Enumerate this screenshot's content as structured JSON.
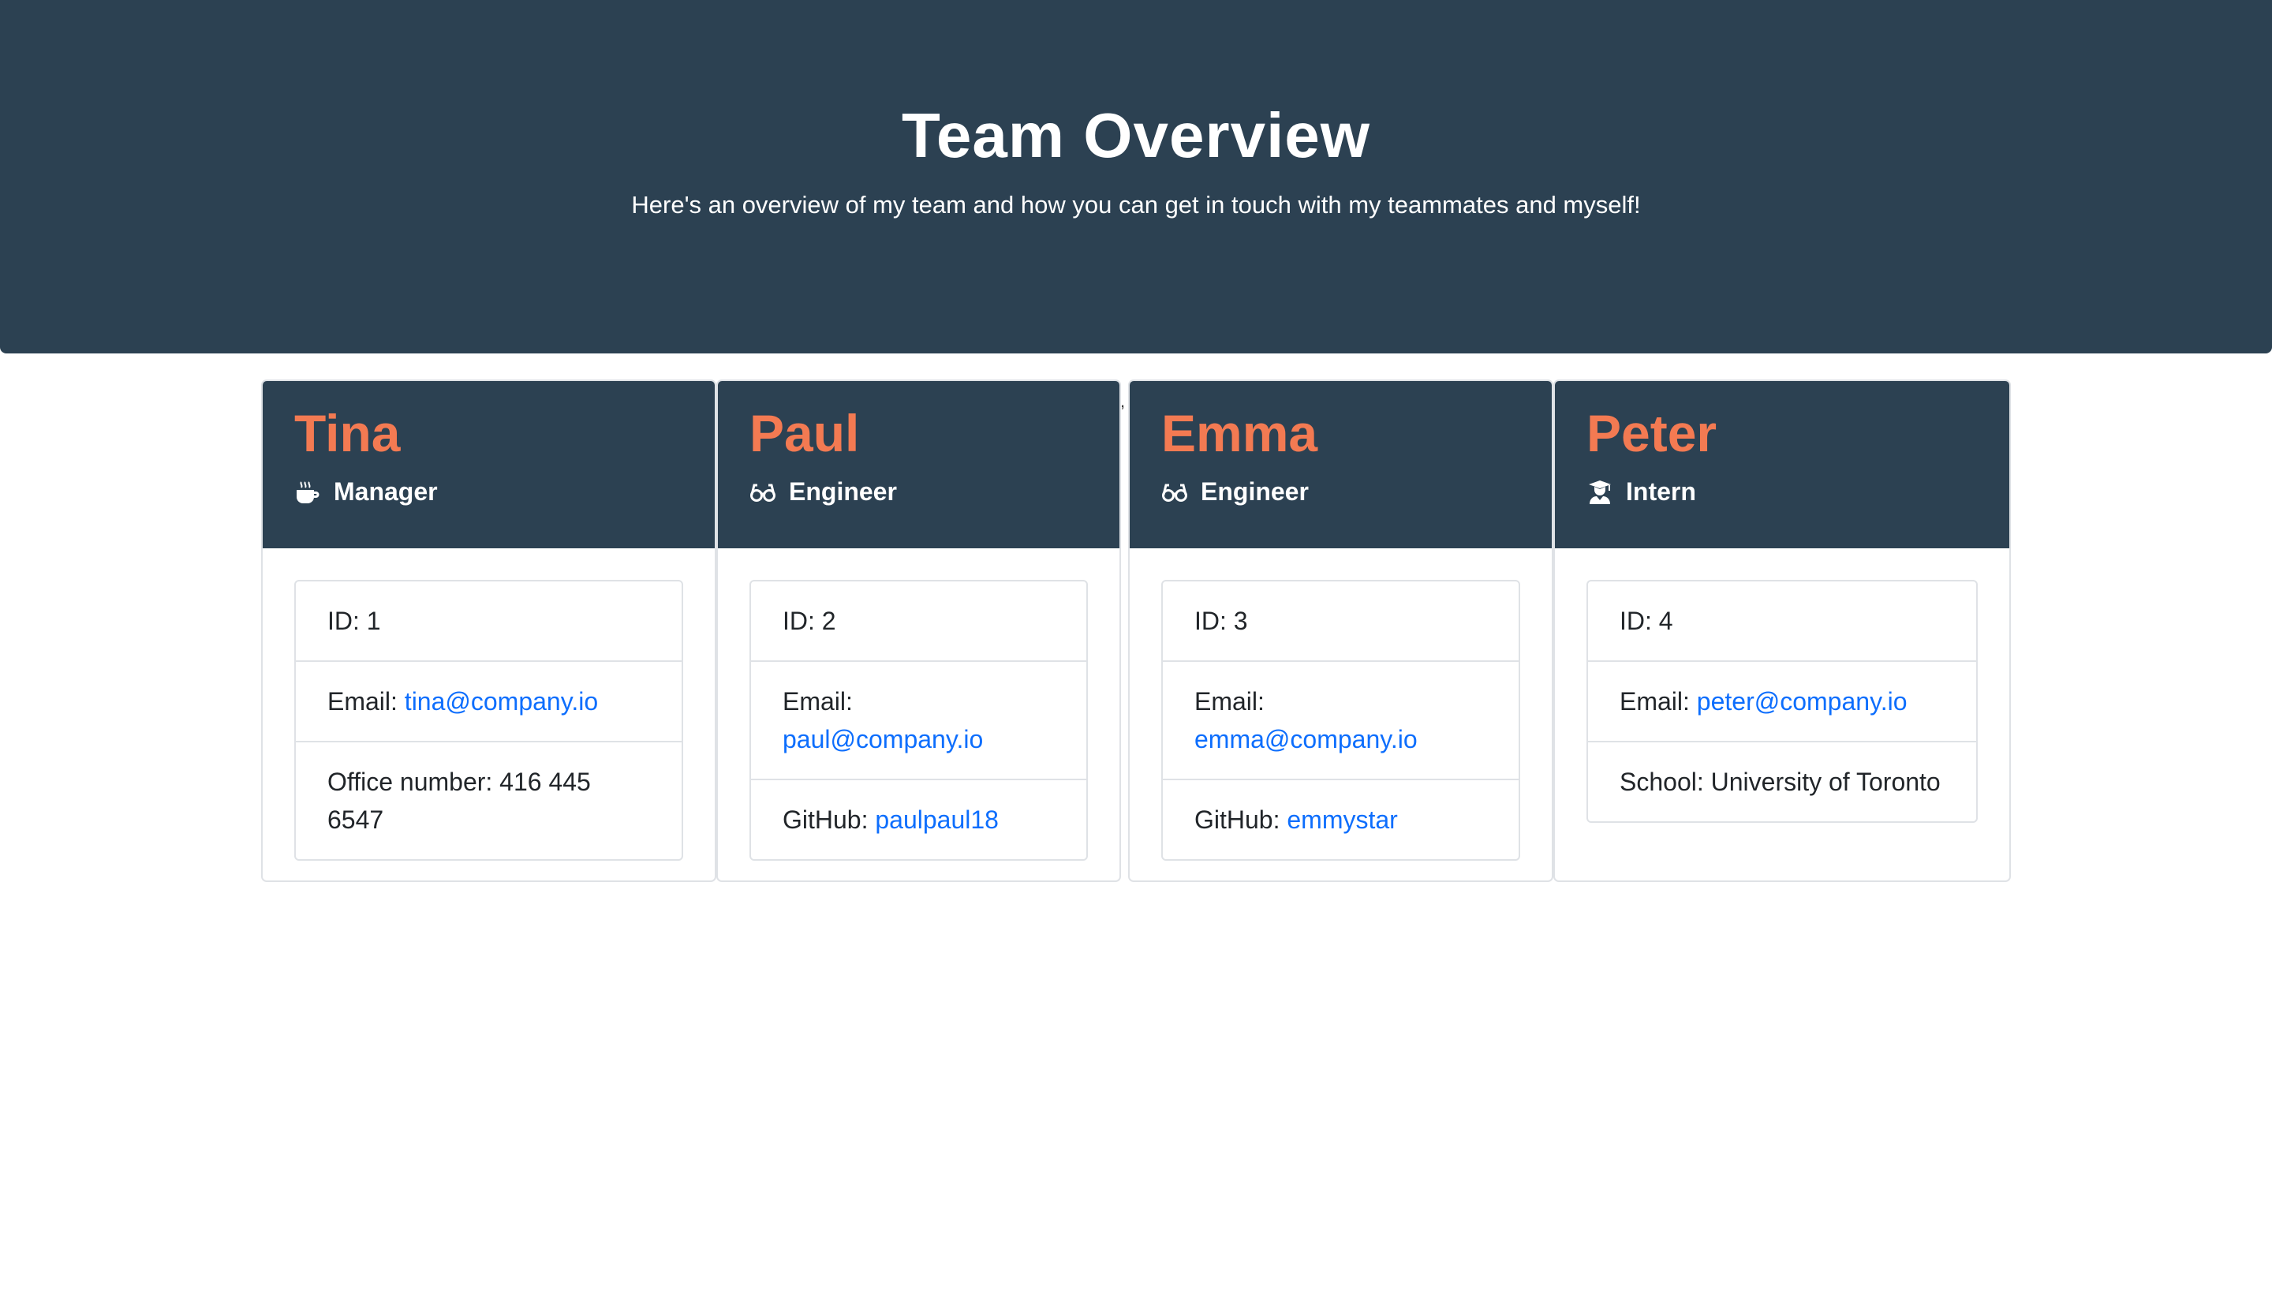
{
  "header": {
    "title": "Team Overview",
    "subtitle": "Here's an overview of my team and how you can get in touch with my teammates and myself!"
  },
  "stray_mark": ",",
  "colors": {
    "header_bg": "#2c4152",
    "name": "#f37a52",
    "link": "#0d6efd"
  },
  "cards": [
    {
      "name": "Tina",
      "role": "Manager",
      "icon": "coffee-icon",
      "id_label": "ID: 1",
      "email_label": "Email:",
      "email": "tina@company.io",
      "extra_label": "Office number: 416 445 6547",
      "extra_link": ""
    },
    {
      "name": "Paul",
      "role": "Engineer",
      "icon": "glasses-icon",
      "id_label": "ID: 2",
      "email_label": "Email:",
      "email": "paul@company.io",
      "extra_label": "GitHub:",
      "extra_link": "paulpaul18"
    },
    {
      "name": "Emma",
      "role": "Engineer",
      "icon": "glasses-icon",
      "id_label": "ID: 3",
      "email_label": "Email:",
      "email": "emma@company.io",
      "extra_label": "GitHub:",
      "extra_link": "emmystar"
    },
    {
      "name": "Peter",
      "role": "Intern",
      "icon": "graduate-icon",
      "id_label": "ID: 4",
      "email_label": "Email:",
      "email": "peter@company.io",
      "extra_label": "School: University of Toronto",
      "extra_link": ""
    }
  ]
}
